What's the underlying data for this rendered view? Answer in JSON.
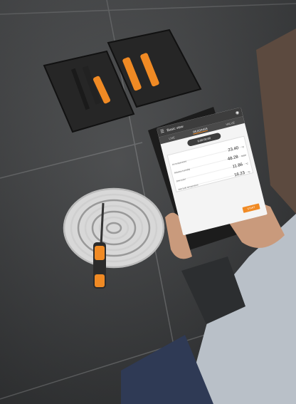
{
  "scene": {
    "description_icons": [
      "case-icon",
      "probe-icon",
      "tablet-icon",
      "hand-icon",
      "floor-drain-icon"
    ]
  },
  "tablet": {
    "app_title": "Basic view",
    "tabs": [
      "LIVE",
      "READINGS",
      "VALUE"
    ],
    "active_tab": "READINGS",
    "timer": "0:00:00:00",
    "readings": [
      {
        "label": "Air temperature",
        "value": "23.40",
        "unit": "°C"
      },
      {
        "label": "Relative humidity",
        "value": "48.28",
        "unit": "%RH"
      },
      {
        "label": "Dew point",
        "value": "11.86",
        "unit": "°C"
      },
      {
        "label": "Wet bulb temperature",
        "value": "16.23",
        "unit": "°C"
      }
    ],
    "start_label": "START"
  },
  "colors": {
    "accent": "#f08a24",
    "floor": "#3b3d3f",
    "case": "#2a2a2a"
  }
}
